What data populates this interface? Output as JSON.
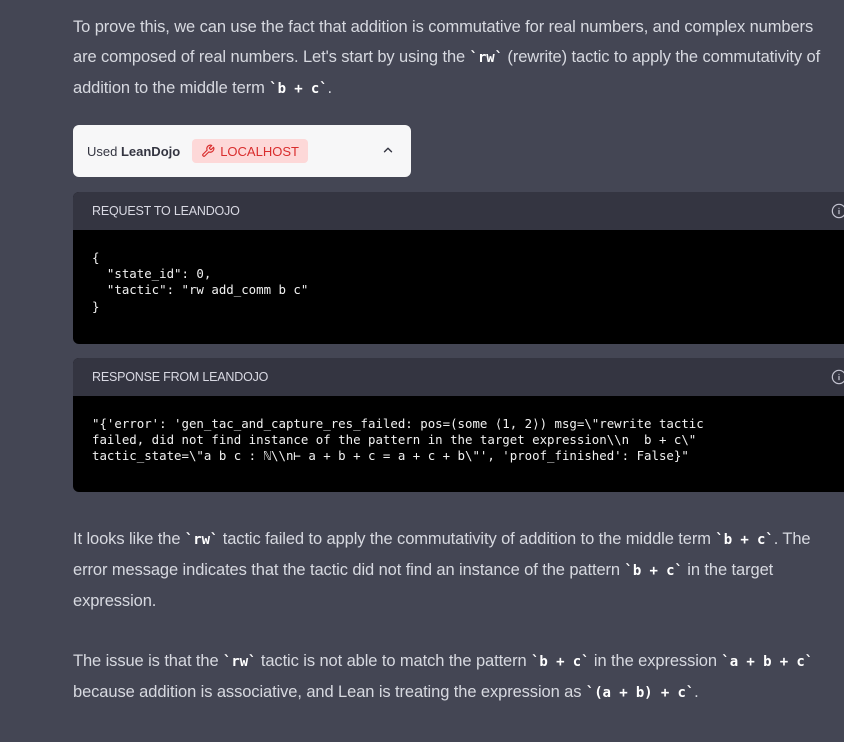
{
  "para1": {
    "t1": "To prove this, we can use the fact that addition is commutative for real numbers, and complex numbers are composed of real numbers. Let's start by using the ",
    "c1": "`rw`",
    "t2": " (rewrite) tactic to apply the commutativity of addition to the middle term ",
    "c2": "`b + c`",
    "t3": "."
  },
  "plugin": {
    "used": "Used ",
    "name": "LeanDojo",
    "badge": "LOCALHOST",
    "badge_color": "#d92d2d",
    "badge_bg": "#fdd8d8",
    "badge_icon": "wrench-icon",
    "toggle_icon": "chevron-up-icon"
  },
  "request": {
    "title": "REQUEST TO LEANDOJO",
    "icon": "info-icon",
    "body": "{\n  \"state_id\": 0,\n  \"tactic\": \"rw add_comm b c\"\n}"
  },
  "response": {
    "title": "RESPONSE FROM LEANDOJO",
    "icon": "info-icon",
    "body": "\"{'error': 'gen_tac_and_capture_res_failed: pos=(some ⟨1, 2⟩) msg=\\\"rewrite tactic\nfailed, did not find instance of the pattern in the target expression\\\\n  b + c\\\"\ntactic_state=\\\"a b c : ℕ\\\\n⊢ a + b + c = a + c + b\\\"', 'proof_finished': False}\""
  },
  "para2": {
    "t1": "It looks like the ",
    "c1": "`rw`",
    "t2": " tactic failed to apply the commutativity of addition to the middle term ",
    "c2": "`b + c`",
    "t3": ". The error message indicates that the tactic did not find an instance of the pattern ",
    "c3": "`b + c`",
    "t4": " in the target expression."
  },
  "para3": {
    "t1": "The issue is that the ",
    "c1": "`rw`",
    "t2": " tactic is not able to match the pattern ",
    "c2": "`b + c`",
    "t3": " in the expression ",
    "c3": "`a + b + c`",
    "t4": " because addition is associative, and Lean is treating the expression as ",
    "c4": "`(a + b) + c`",
    "t5": "."
  },
  "colors": {
    "background": "#444654",
    "text": "#d7d9e0",
    "panel_header": "#343541",
    "code_bg": "#000000"
  }
}
